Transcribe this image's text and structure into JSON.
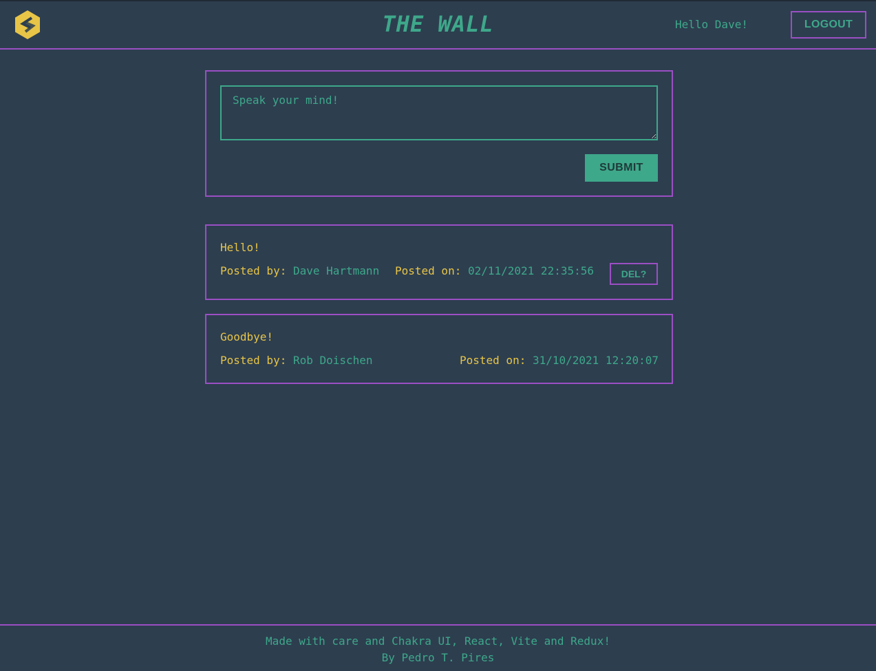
{
  "header": {
    "logo_icon": "hexagon-logo-icon",
    "title": "THE WALL",
    "greeting": "Hello Dave!",
    "logout_label": "LOGOUT"
  },
  "composer": {
    "placeholder": "Speak your mind!",
    "value": "",
    "submit_label": "SUBMIT"
  },
  "posts": [
    {
      "message": "Hello!",
      "posted_by_label": "Posted by:",
      "author": "Dave Hartmann",
      "posted_on_label": "Posted on:",
      "date": "02/11/2021 22:35:56",
      "delete_label": "DEL?"
    },
    {
      "message": "Goodbye!",
      "posted_by_label": "Posted by:",
      "author": "Rob Doischen",
      "posted_on_label": "Posted on:",
      "date": "31/10/2021 12:20:07"
    }
  ],
  "footer": {
    "line1": "Made with care and Chakra UI, React, Vite and Redux!",
    "line2": "By Pedro T. Pires"
  },
  "colors": {
    "background": "#2d3e4f",
    "border": "#9b4fc4",
    "accent": "#3ea88a",
    "text_yellow": "#e8c547"
  }
}
